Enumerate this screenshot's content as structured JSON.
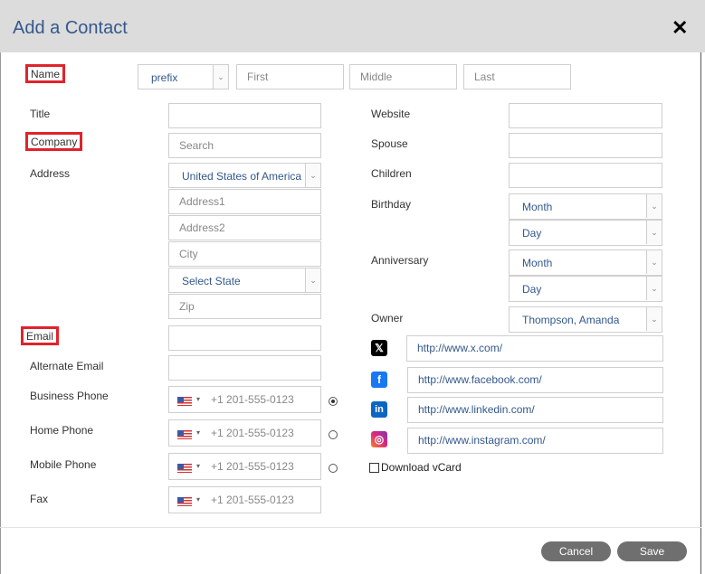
{
  "dialog": {
    "title": "Add a Contact",
    "close_glyph": "✕"
  },
  "name": {
    "label": "Name",
    "prefix_value": "prefix",
    "first_placeholder": "First",
    "middle_placeholder": "Middle",
    "last_placeholder": "Last"
  },
  "labels": {
    "title": "Title",
    "company": "Company",
    "address": "Address",
    "email": "Email",
    "alternate_email": "Alternate Email",
    "business_phone": "Business Phone",
    "home_phone": "Home Phone",
    "mobile_phone": "Mobile Phone",
    "fax": "Fax",
    "website": "Website",
    "spouse": "Spouse",
    "children": "Children",
    "birthday": "Birthday",
    "anniversary": "Anniversary",
    "owner": "Owner"
  },
  "company": {
    "placeholder": "Search"
  },
  "address": {
    "country_value": "United States of America",
    "address1_placeholder": "Address1",
    "address2_placeholder": "Address2",
    "city_placeholder": "City",
    "state_value": "Select State",
    "zip_placeholder": "Zip"
  },
  "phone": {
    "placeholder": "+1 201-555-0123",
    "primary": "business"
  },
  "birthday": {
    "month": "Month",
    "day": "Day"
  },
  "anniversary": {
    "month": "Month",
    "day": "Day"
  },
  "owner": {
    "value": "Thompson, Amanda"
  },
  "social": [
    {
      "name": "x",
      "icon": "x-icon",
      "url": "http://www.x.com/",
      "color": "#000000",
      "glyph": "𝕏"
    },
    {
      "name": "facebook",
      "icon": "facebook-icon",
      "url": "http://www.facebook.com/",
      "color": "#1877f2",
      "glyph": "f"
    },
    {
      "name": "linkedin",
      "icon": "linkedin-icon",
      "url": "http://www.linkedin.com/",
      "color": "#0a66c2",
      "glyph": "in"
    },
    {
      "name": "instagram",
      "icon": "instagram-icon",
      "url": "http://www.instagram.com/",
      "color": "#e1306c",
      "glyph": "◎"
    }
  ],
  "vcard": {
    "label": "Download vCard",
    "checked": false
  },
  "footer": {
    "cancel_label": "Cancel",
    "save_label": "Save"
  },
  "colors": {
    "required_outline": "#e0232b",
    "accent_text": "#34588c",
    "header_bg": "#dcdcdc"
  }
}
